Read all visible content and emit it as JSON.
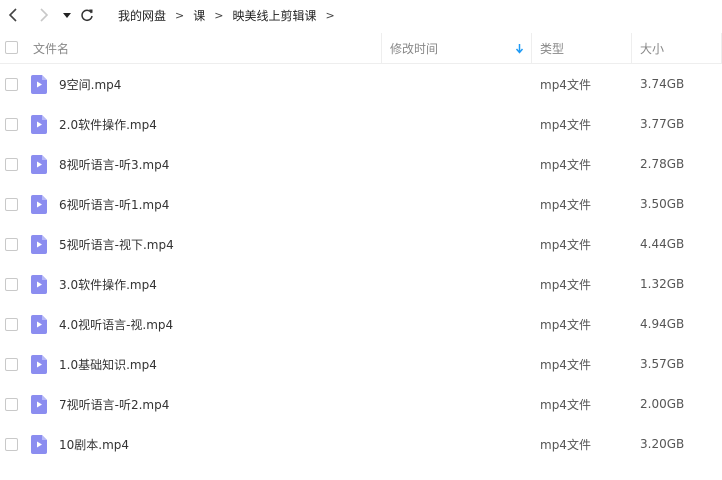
{
  "toolbar": {
    "back_icon": "chevron-left-icon",
    "forward_icon": "chevron-right-icon",
    "history_icon": "caret-down-icon",
    "refresh_icon": "refresh-icon"
  },
  "breadcrumb": {
    "items": [
      "我的网盘",
      "课",
      "映美线上剪辑课"
    ],
    "separator": ">"
  },
  "table": {
    "headers": {
      "name": "文件名",
      "modified": "修改时间",
      "type": "类型",
      "size": "大小"
    },
    "sort_icon": "arrow-down-icon",
    "rows": [
      {
        "name": "9空间.mp4",
        "type": "mp4文件",
        "size": "3.74GB"
      },
      {
        "name": "2.0软件操作.mp4",
        "type": "mp4文件",
        "size": "3.77GB"
      },
      {
        "name": "8视听语言-听3.mp4",
        "type": "mp4文件",
        "size": "2.78GB"
      },
      {
        "name": "6视听语言-听1.mp4",
        "type": "mp4文件",
        "size": "3.50GB"
      },
      {
        "name": "5视听语言-视下.mp4",
        "type": "mp4文件",
        "size": "4.44GB"
      },
      {
        "name": "3.0软件操作.mp4",
        "type": "mp4文件",
        "size": "1.32GB"
      },
      {
        "name": "4.0视听语言-视.mp4",
        "type": "mp4文件",
        "size": "4.94GB"
      },
      {
        "name": "1.0基础知识.mp4",
        "type": "mp4文件",
        "size": "3.57GB"
      },
      {
        "name": "7视听语言-听2.mp4",
        "type": "mp4文件",
        "size": "2.00GB"
      },
      {
        "name": "10剧本.mp4",
        "type": "mp4文件",
        "size": "3.20GB"
      }
    ]
  },
  "colors": {
    "video_icon": "#8b8df0",
    "sort_arrow": "#1e9af5",
    "divider": "#eeeeee"
  }
}
